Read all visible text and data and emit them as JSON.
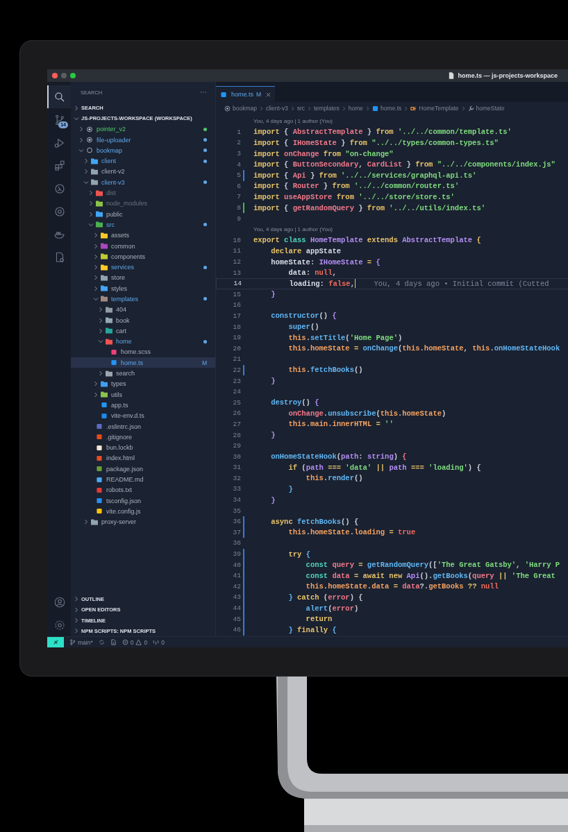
{
  "window": {
    "title": "home.ts — js-projects-workspace"
  },
  "activity_bar": {
    "items": [
      {
        "selected": true
      },
      {
        "selected": false,
        "badge": "14"
      },
      {
        "selected": false
      },
      {
        "selected": false
      },
      {
        "selected": false
      },
      {
        "selected": false
      },
      {
        "selected": false
      },
      {
        "selected": false
      }
    ]
  },
  "sidebar": {
    "title": "SEARCH",
    "sections": [
      {
        "label": "SEARCH",
        "expanded": false
      },
      {
        "label": "JS-PROJECTS-WORKSPACE (WORKSPACE)",
        "expanded": true,
        "children": [
          {
            "label": "pointer_v2",
            "kind": "root",
            "untracked": true,
            "modified": false,
            "ignored": false,
            "expanded": false,
            "selected": false
          },
          {
            "label": "file-uploader",
            "kind": "root",
            "untracked": false,
            "modified": true,
            "ignored": false,
            "expanded": false,
            "selected": false
          },
          {
            "label": "bookmap",
            "kind": "root",
            "untracked": false,
            "modified": true,
            "ignored": false,
            "expanded": true,
            "selected": false,
            "children": [
              {
                "label": "client",
                "kind": "folder",
                "color": "#42a5f5",
                "untracked": false,
                "modified": true,
                "ignored": false,
                "expanded": false,
                "selected": false
              },
              {
                "label": "client-v2",
                "kind": "folder",
                "color": "#90a4ae",
                "untracked": false,
                "modified": false,
                "ignored": false,
                "expanded": false,
                "selected": false
              },
              {
                "label": "client-v3",
                "kind": "folder",
                "color": "#90a4ae",
                "untracked": false,
                "modified": true,
                "ignored": false,
                "expanded": true,
                "selected": false,
                "children": [
                  {
                    "label": "dist",
                    "kind": "folder",
                    "color": "#ef5350",
                    "untracked": false,
                    "modified": false,
                    "ignored": true,
                    "expanded": false,
                    "selected": false
                  },
                  {
                    "label": "node_modules",
                    "kind": "folder",
                    "color": "#8bc34a",
                    "untracked": false,
                    "modified": false,
                    "ignored": true,
                    "expanded": false,
                    "selected": false
                  },
                  {
                    "label": "public",
                    "kind": "folder",
                    "color": "#42a5f5",
                    "untracked": false,
                    "modified": false,
                    "ignored": false,
                    "expanded": false,
                    "selected": false
                  },
                  {
                    "label": "src",
                    "kind": "folder",
                    "color": "#4caf50",
                    "untracked": false,
                    "modified": true,
                    "ignored": false,
                    "expanded": true,
                    "selected": false,
                    "children": [
                      {
                        "label": "assets",
                        "kind": "folder",
                        "color": "#ffca28",
                        "untracked": false,
                        "modified": false,
                        "ignored": false,
                        "expanded": false,
                        "selected": false
                      },
                      {
                        "label": "common",
                        "kind": "folder",
                        "color": "#ab47bc",
                        "untracked": false,
                        "modified": false,
                        "ignored": false,
                        "expanded": false,
                        "selected": false
                      },
                      {
                        "label": "components",
                        "kind": "folder",
                        "color": "#c0ca33",
                        "untracked": false,
                        "modified": false,
                        "ignored": false,
                        "expanded": false,
                        "selected": false
                      },
                      {
                        "label": "services",
                        "kind": "folder",
                        "color": "#ffca28",
                        "untracked": false,
                        "modified": true,
                        "ignored": false,
                        "expanded": false,
                        "selected": false
                      },
                      {
                        "label": "store",
                        "kind": "folder",
                        "color": "#90a4ae",
                        "untracked": false,
                        "modified": false,
                        "ignored": false,
                        "expanded": false,
                        "selected": false
                      },
                      {
                        "label": "styles",
                        "kind": "folder",
                        "color": "#42a5f5",
                        "untracked": false,
                        "modified": false,
                        "ignored": false,
                        "expanded": false,
                        "selected": false
                      },
                      {
                        "label": "templates",
                        "kind": "folder",
                        "color": "#a1887f",
                        "untracked": false,
                        "modified": true,
                        "ignored": false,
                        "expanded": true,
                        "selected": false,
                        "children": [
                          {
                            "label": "404",
                            "kind": "folder",
                            "color": "#8f9ba5",
                            "untracked": false,
                            "modified": false,
                            "ignored": false,
                            "expanded": false,
                            "selected": false
                          },
                          {
                            "label": "book",
                            "kind": "folder",
                            "color": "#96a8b2",
                            "untracked": false,
                            "modified": false,
                            "ignored": false,
                            "expanded": false,
                            "selected": false
                          },
                          {
                            "label": "cart",
                            "kind": "folder",
                            "color": "#26a69a",
                            "untracked": false,
                            "modified": false,
                            "ignored": false,
                            "expanded": false,
                            "selected": false
                          },
                          {
                            "label": "home",
                            "kind": "folder",
                            "color": "#ef5350",
                            "untracked": false,
                            "modified": true,
                            "ignored": false,
                            "expanded": true,
                            "selected": false,
                            "children": [
                              {
                                "label": "home.scss",
                                "kind": "file",
                                "color": "#ec407a",
                                "untracked": false,
                                "modified": false,
                                "ignored": false,
                                "selected": false
                              },
                              {
                                "label": "home.ts",
                                "kind": "file",
                                "color": "#2196f3",
                                "untracked": false,
                                "modified": true,
                                "ignored": false,
                                "badge": "M",
                                "selected": true
                              }
                            ]
                          },
                          {
                            "label": "search",
                            "kind": "folder",
                            "color": "#9aa6b0",
                            "untracked": false,
                            "modified": false,
                            "ignored": false,
                            "expanded": false,
                            "selected": false
                          }
                        ]
                      },
                      {
                        "label": "types",
                        "kind": "folder",
                        "color": "#3f9ff0",
                        "untracked": false,
                        "modified": false,
                        "ignored": false,
                        "expanded": false,
                        "selected": false
                      },
                      {
                        "label": "utils",
                        "kind": "folder",
                        "color": "#8bc34b",
                        "untracked": false,
                        "modified": false,
                        "ignored": false,
                        "expanded": false,
                        "selected": false
                      },
                      {
                        "label": "app.ts",
                        "kind": "file",
                        "color": "#2196f4",
                        "untracked": false,
                        "modified": false,
                        "ignored": false,
                        "selected": false
                      },
                      {
                        "label": "vite-env.d.ts",
                        "kind": "file",
                        "color": "#1e88e5",
                        "untracked": false,
                        "modified": false,
                        "ignored": false,
                        "selected": false
                      }
                    ]
                  },
                  {
                    "label": ".eslintrc.json",
                    "kind": "file",
                    "color": "#5c6bc0",
                    "untracked": false,
                    "modified": false,
                    "ignored": false,
                    "selected": false
                  },
                  {
                    "label": ".gitignore",
                    "kind": "file",
                    "color": "#e64a19",
                    "untracked": false,
                    "modified": false,
                    "ignored": false,
                    "selected": false
                  },
                  {
                    "label": "bun.lockb",
                    "kind": "file",
                    "color": "#f5e6d3",
                    "untracked": false,
                    "modified": false,
                    "ignored": false,
                    "selected": false
                  },
                  {
                    "label": "index.html",
                    "kind": "file",
                    "color": "#e44d26",
                    "untracked": false,
                    "modified": false,
                    "ignored": false,
                    "selected": false
                  },
                  {
                    "label": "package.json",
                    "kind": "file",
                    "color": "#689f38",
                    "untracked": false,
                    "modified": false,
                    "ignored": false,
                    "selected": false
                  },
                  {
                    "label": "README.md",
                    "kind": "file",
                    "color": "#4aa8f5",
                    "untracked": false,
                    "modified": false,
                    "ignored": false,
                    "selected": false
                  },
                  {
                    "label": "robots.txt",
                    "kind": "file",
                    "color": "#e53935",
                    "untracked": false,
                    "modified": false,
                    "ignored": false,
                    "selected": false
                  },
                  {
                    "label": "tsconfig.json",
                    "kind": "file",
                    "color": "#2a8ef0",
                    "untracked": false,
                    "modified": false,
                    "ignored": false,
                    "selected": false
                  },
                  {
                    "label": "vite.config.js",
                    "kind": "file",
                    "color": "#ffc107",
                    "untracked": false,
                    "modified": false,
                    "ignored": false,
                    "selected": false
                  }
                ]
              },
              {
                "label": "proxy-server",
                "kind": "folder",
                "color": "#91a5af",
                "untracked": false,
                "modified": false,
                "ignored": false,
                "expanded": false,
                "selected": false
              }
            ]
          }
        ]
      }
    ],
    "bottom_sections": [
      {
        "label": "OUTLINE",
        "expanded": false
      },
      {
        "label": "OPEN EDITORS",
        "expanded": false
      },
      {
        "label": "TIMELINE",
        "expanded": false
      },
      {
        "label": "NPM SCRIPTS: NPM SCRIPTS",
        "expanded": false
      }
    ]
  },
  "editor": {
    "tabs": [
      {
        "label": "home.ts",
        "badge": "M",
        "selected": true
      }
    ],
    "breadcrumb": [
      {
        "kind": "root",
        "label": "bookmap"
      },
      {
        "kind": "folder",
        "label": "client-v3"
      },
      {
        "kind": "folder",
        "label": "src"
      },
      {
        "kind": "folder",
        "label": "templates"
      },
      {
        "kind": "folder",
        "label": "home"
      },
      {
        "kind": "file",
        "label": "home.ts"
      },
      {
        "kind": "class",
        "label": "HomeTemplate"
      },
      {
        "kind": "property",
        "label": "homeState"
      }
    ],
    "lines": [
      {
        "kind": "lens",
        "text": "You, 4 days ago | 1 author (You)"
      },
      {
        "kind": "code",
        "number": "1",
        "current": false,
        "added": false,
        "modified": false,
        "tokens": [
          {
            "kind": "kw",
            "text": "import "
          },
          {
            "kind": "punct",
            "text": "{ "
          },
          {
            "kind": "name",
            "text": "AbstractTemplate"
          },
          {
            "kind": "punct",
            "text": " } "
          },
          {
            "kind": "kw",
            "text": "from "
          },
          {
            "kind": "str",
            "text": "'../../common/template.ts'"
          }
        ]
      },
      {
        "kind": "code",
        "number": "2",
        "current": false,
        "added": false,
        "modified": false,
        "tokens": [
          {
            "kind": "kw",
            "text": "import "
          },
          {
            "kind": "punct",
            "text": "{ "
          },
          {
            "kind": "name",
            "text": "IHomeState"
          },
          {
            "kind": "punct",
            "text": " } "
          },
          {
            "kind": "kw",
            "text": "from "
          },
          {
            "kind": "str",
            "text": "\"../../types/common-types.ts\""
          }
        ]
      },
      {
        "kind": "code",
        "number": "3",
        "current": false,
        "added": false,
        "modified": false,
        "tokens": [
          {
            "kind": "kw",
            "text": "import "
          },
          {
            "kind": "name",
            "text": "onChange "
          },
          {
            "kind": "kw",
            "text": "from "
          },
          {
            "kind": "str",
            "text": "\"on-change\""
          }
        ]
      },
      {
        "kind": "code",
        "number": "4",
        "current": false,
        "added": false,
        "modified": false,
        "tokens": [
          {
            "kind": "kw",
            "text": "import "
          },
          {
            "kind": "punct",
            "text": "{ "
          },
          {
            "kind": "name",
            "text": "ButtonSecondary"
          },
          {
            "kind": "punct",
            "text": ", "
          },
          {
            "kind": "name",
            "text": "CardList"
          },
          {
            "kind": "punct",
            "text": " } "
          },
          {
            "kind": "kw",
            "text": "from "
          },
          {
            "kind": "str",
            "text": "\"../../components/index.js\""
          }
        ]
      },
      {
        "kind": "code",
        "number": "5",
        "current": false,
        "added": false,
        "modified": true,
        "tokens": [
          {
            "kind": "kw",
            "text": "import "
          },
          {
            "kind": "punct",
            "text": "{ "
          },
          {
            "kind": "name",
            "text": "Api"
          },
          {
            "kind": "punct",
            "text": " } "
          },
          {
            "kind": "kw",
            "text": "from "
          },
          {
            "kind": "str",
            "text": "'../../services/graphql-api.ts'"
          }
        ]
      },
      {
        "kind": "code",
        "number": "6",
        "current": false,
        "added": false,
        "modified": false,
        "tokens": [
          {
            "kind": "kw",
            "text": "import "
          },
          {
            "kind": "punct",
            "text": "{ "
          },
          {
            "kind": "name",
            "text": "Router"
          },
          {
            "kind": "punct",
            "text": " } "
          },
          {
            "kind": "kw",
            "text": "from "
          },
          {
            "kind": "str",
            "text": "'../../common/router.ts'"
          }
        ]
      },
      {
        "kind": "code",
        "number": "7",
        "current": false,
        "added": false,
        "modified": false,
        "tokens": [
          {
            "kind": "kw",
            "text": "import "
          },
          {
            "kind": "name",
            "text": "useAppStore "
          },
          {
            "kind": "kw",
            "text": "from "
          },
          {
            "kind": "str",
            "text": "'../../store/store.ts'"
          }
        ]
      },
      {
        "kind": "code",
        "number": "8",
        "current": false,
        "added": true,
        "modified": false,
        "tokens": [
          {
            "kind": "kw",
            "text": "import "
          },
          {
            "kind": "punct",
            "text": "{ "
          },
          {
            "kind": "name",
            "text": "getRandomQuery"
          },
          {
            "kind": "punct",
            "text": " } "
          },
          {
            "kind": "kw",
            "text": "from "
          },
          {
            "kind": "str",
            "text": "'../../utils/index.ts'"
          }
        ]
      },
      {
        "kind": "code",
        "number": "9",
        "current": false,
        "added": false,
        "modified": false
      },
      {
        "kind": "lens",
        "text": "You, 4 days ago | 1 author (You)"
      },
      {
        "kind": "code",
        "number": "10",
        "current": false,
        "added": false,
        "modified": false,
        "tokens": [
          {
            "kind": "kw",
            "text": "export "
          },
          {
            "kind": "kw2",
            "text": "class "
          },
          {
            "kind": "type",
            "text": "HomeTemplate "
          },
          {
            "kind": "kw",
            "text": "extends "
          },
          {
            "kind": "type",
            "text": "AbstractTemplate "
          },
          {
            "kind": "op",
            "text": "{"
          }
        ]
      },
      {
        "kind": "code",
        "number": "11",
        "current": false,
        "added": false,
        "modified": false,
        "tokens": [
          {
            "kind": "kw",
            "text": "    declare "
          },
          {
            "kind": "plain",
            "text": "appState"
          }
        ]
      },
      {
        "kind": "code",
        "number": "12",
        "current": false,
        "added": false,
        "modified": false,
        "tokens": [
          {
            "kind": "plain",
            "text": "    homeState"
          },
          {
            "kind": "punct",
            "text": ": "
          },
          {
            "kind": "type",
            "text": "IHomeState "
          },
          {
            "kind": "op",
            "text": "= "
          },
          {
            "kind": "type",
            "text": "{"
          }
        ]
      },
      {
        "kind": "code",
        "number": "13",
        "current": false,
        "added": false,
        "modified": false,
        "tokens": [
          {
            "kind": "plain",
            "text": "        data"
          },
          {
            "kind": "punct",
            "text": ": "
          },
          {
            "kind": "lit",
            "text": "null"
          },
          {
            "kind": "punct",
            "text": ","
          }
        ]
      },
      {
        "kind": "code",
        "number": "14",
        "current": true,
        "added": false,
        "modified": false,
        "blame": "You, 4 days ago • Initial commit (Cutted",
        "tokens": [
          {
            "kind": "plain",
            "text": "        loading"
          },
          {
            "kind": "punct",
            "text": ": "
          },
          {
            "kind": "lit",
            "text": "false"
          },
          {
            "kind": "punct",
            "text": ","
          }
        ]
      },
      {
        "kind": "code",
        "number": "15",
        "current": false,
        "added": false,
        "modified": false,
        "tokens": [
          {
            "kind": "type",
            "text": "    }"
          }
        ]
      },
      {
        "kind": "code",
        "number": "16",
        "current": false,
        "added": false,
        "modified": false
      },
      {
        "kind": "code",
        "number": "17",
        "current": false,
        "added": false,
        "modified": false,
        "tokens": [
          {
            "kind": "fn",
            "text": "    constructor"
          },
          {
            "kind": "punct",
            "text": "() "
          },
          {
            "kind": "type",
            "text": "{"
          }
        ]
      },
      {
        "kind": "code",
        "number": "18",
        "current": false,
        "added": false,
        "modified": false,
        "tokens": [
          {
            "kind": "fn",
            "text": "        super"
          },
          {
            "kind": "punct",
            "text": "()"
          }
        ]
      },
      {
        "kind": "code",
        "number": "19",
        "current": false,
        "added": false,
        "modified": false,
        "tokens": [
          {
            "kind": "this",
            "text": "        this"
          },
          {
            "kind": "punct",
            "text": "."
          },
          {
            "kind": "fn",
            "text": "setTitle"
          },
          {
            "kind": "punct",
            "text": "("
          },
          {
            "kind": "str",
            "text": "'Home Page'"
          },
          {
            "kind": "punct",
            "text": ")"
          }
        ]
      },
      {
        "kind": "code",
        "number": "20",
        "current": false,
        "added": false,
        "modified": false,
        "tokens": [
          {
            "kind": "this",
            "text": "        this"
          },
          {
            "kind": "punct",
            "text": "."
          },
          {
            "kind": "prop",
            "text": "homeState "
          },
          {
            "kind": "op",
            "text": "= "
          },
          {
            "kind": "fn",
            "text": "onChange"
          },
          {
            "kind": "punct",
            "text": "("
          },
          {
            "kind": "this",
            "text": "this"
          },
          {
            "kind": "punct",
            "text": "."
          },
          {
            "kind": "prop",
            "text": "homeState"
          },
          {
            "kind": "punct",
            "text": ", "
          },
          {
            "kind": "this",
            "text": "this"
          },
          {
            "kind": "punct",
            "text": "."
          },
          {
            "kind": "fn",
            "text": "onHomeStateHook"
          }
        ]
      },
      {
        "kind": "code",
        "number": "21",
        "current": false,
        "added": false,
        "modified": false
      },
      {
        "kind": "code",
        "number": "22",
        "current": false,
        "added": false,
        "modified": true,
        "tokens": [
          {
            "kind": "this",
            "text": "        this"
          },
          {
            "kind": "punct",
            "text": "."
          },
          {
            "kind": "fn",
            "text": "fetchBooks"
          },
          {
            "kind": "punct",
            "text": "()"
          }
        ]
      },
      {
        "kind": "code",
        "number": "23",
        "current": false,
        "added": false,
        "modified": false,
        "tokens": [
          {
            "kind": "type",
            "text": "    }"
          }
        ]
      },
      {
        "kind": "code",
        "number": "24",
        "current": false,
        "added": false,
        "modified": false
      },
      {
        "kind": "code",
        "number": "25",
        "current": false,
        "added": false,
        "modified": false,
        "tokens": [
          {
            "kind": "fn",
            "text": "    destroy"
          },
          {
            "kind": "punct",
            "text": "() "
          },
          {
            "kind": "type",
            "text": "{"
          }
        ]
      },
      {
        "kind": "code",
        "number": "26",
        "current": false,
        "added": false,
        "modified": false,
        "tokens": [
          {
            "kind": "name",
            "text": "        onChange"
          },
          {
            "kind": "punct",
            "text": "."
          },
          {
            "kind": "fn",
            "text": "unsubscribe"
          },
          {
            "kind": "punct",
            "text": "("
          },
          {
            "kind": "this",
            "text": "this"
          },
          {
            "kind": "punct",
            "text": "."
          },
          {
            "kind": "prop",
            "text": "homeState"
          },
          {
            "kind": "punct",
            "text": ")"
          }
        ]
      },
      {
        "kind": "code",
        "number": "27",
        "current": false,
        "added": false,
        "modified": false,
        "tokens": [
          {
            "kind": "this",
            "text": "        this"
          },
          {
            "kind": "punct",
            "text": "."
          },
          {
            "kind": "prop",
            "text": "main"
          },
          {
            "kind": "punct",
            "text": "."
          },
          {
            "kind": "prop",
            "text": "innerHTML "
          },
          {
            "kind": "op",
            "text": "= "
          },
          {
            "kind": "str",
            "text": "''"
          }
        ]
      },
      {
        "kind": "code",
        "number": "28",
        "current": false,
        "added": false,
        "modified": false,
        "tokens": [
          {
            "kind": "type",
            "text": "    }"
          }
        ]
      },
      {
        "kind": "code",
        "number": "29",
        "current": false,
        "added": false,
        "modified": false
      },
      {
        "kind": "code",
        "number": "30",
        "current": false,
        "added": false,
        "modified": false,
        "tokens": [
          {
            "kind": "fn",
            "text": "    onHomeStateHook"
          },
          {
            "kind": "punct",
            "text": "("
          },
          {
            "kind": "type",
            "text": "path"
          },
          {
            "kind": "punct",
            "text": ": "
          },
          {
            "kind": "type",
            "text": "string"
          },
          {
            "kind": "punct",
            "text": ") "
          },
          {
            "kind": "name",
            "text": "{"
          }
        ]
      },
      {
        "kind": "code",
        "number": "31",
        "current": false,
        "added": false,
        "modified": false,
        "tokens": [
          {
            "kind": "kw",
            "text": "        if "
          },
          {
            "kind": "punct",
            "text": "("
          },
          {
            "kind": "type",
            "text": "path "
          },
          {
            "kind": "op",
            "text": "=== "
          },
          {
            "kind": "str",
            "text": "'data' "
          },
          {
            "kind": "op",
            "text": "|| "
          },
          {
            "kind": "type",
            "text": "path "
          },
          {
            "kind": "op",
            "text": "=== "
          },
          {
            "kind": "str",
            "text": "'loading'"
          },
          {
            "kind": "punct",
            "text": ") {"
          }
        ]
      },
      {
        "kind": "code",
        "number": "32",
        "current": false,
        "added": false,
        "modified": false,
        "tokens": [
          {
            "kind": "this",
            "text": "            this"
          },
          {
            "kind": "punct",
            "text": "."
          },
          {
            "kind": "fn",
            "text": "render"
          },
          {
            "kind": "punct",
            "text": "()"
          }
        ]
      },
      {
        "kind": "code",
        "number": "33",
        "current": false,
        "added": false,
        "modified": false,
        "tokens": [
          {
            "kind": "fn",
            "text": "        }"
          }
        ]
      },
      {
        "kind": "code",
        "number": "34",
        "current": false,
        "added": false,
        "modified": false,
        "tokens": [
          {
            "kind": "type",
            "text": "    }"
          }
        ]
      },
      {
        "kind": "code",
        "number": "35",
        "current": false,
        "added": false,
        "modified": false
      },
      {
        "kind": "code",
        "number": "36",
        "current": false,
        "added": false,
        "modified": true,
        "tokens": [
          {
            "kind": "kw",
            "text": "    async "
          },
          {
            "kind": "fn",
            "text": "fetchBooks"
          },
          {
            "kind": "punct",
            "text": "() {"
          }
        ]
      },
      {
        "kind": "code",
        "number": "37",
        "current": false,
        "added": false,
        "modified": true,
        "tokens": [
          {
            "kind": "this",
            "text": "        this"
          },
          {
            "kind": "punct",
            "text": "."
          },
          {
            "kind": "prop",
            "text": "homeState"
          },
          {
            "kind": "punct",
            "text": "."
          },
          {
            "kind": "prop",
            "text": "loading "
          },
          {
            "kind": "op",
            "text": "= "
          },
          {
            "kind": "lit",
            "text": "true"
          }
        ]
      },
      {
        "kind": "code",
        "number": "38",
        "current": false,
        "added": false,
        "modified": false
      },
      {
        "kind": "code",
        "number": "39",
        "current": false,
        "added": false,
        "modified": true,
        "tokens": [
          {
            "kind": "kw",
            "text": "        try "
          },
          {
            "kind": "fn",
            "text": "{"
          }
        ]
      },
      {
        "kind": "code",
        "number": "40",
        "current": false,
        "added": false,
        "modified": true,
        "tokens": [
          {
            "kind": "kw2",
            "text": "            const "
          },
          {
            "kind": "name",
            "text": "query "
          },
          {
            "kind": "op",
            "text": "= "
          },
          {
            "kind": "fn",
            "text": "getRandomQuery"
          },
          {
            "kind": "punct",
            "text": "(["
          },
          {
            "kind": "str",
            "text": "'The Great Gatsby'"
          },
          {
            "kind": "punct",
            "text": ", "
          },
          {
            "kind": "str",
            "text": "'Harry P"
          }
        ]
      },
      {
        "kind": "code",
        "number": "41",
        "current": false,
        "added": false,
        "modified": true,
        "tokens": [
          {
            "kind": "kw2",
            "text": "            const "
          },
          {
            "kind": "name",
            "text": "data "
          },
          {
            "kind": "op",
            "text": "= "
          },
          {
            "kind": "kw",
            "text": "await new "
          },
          {
            "kind": "type",
            "text": "Api"
          },
          {
            "kind": "punct",
            "text": "()."
          },
          {
            "kind": "fn",
            "text": "getBooks"
          },
          {
            "kind": "punct",
            "text": "("
          },
          {
            "kind": "name",
            "text": "query "
          },
          {
            "kind": "op",
            "text": "|| "
          },
          {
            "kind": "str",
            "text": "'The Great"
          }
        ]
      },
      {
        "kind": "code",
        "number": "42",
        "current": false,
        "added": false,
        "modified": true,
        "tokens": [
          {
            "kind": "this",
            "text": "            this"
          },
          {
            "kind": "punct",
            "text": "."
          },
          {
            "kind": "prop",
            "text": "homeState"
          },
          {
            "kind": "punct",
            "text": "."
          },
          {
            "kind": "prop",
            "text": "data "
          },
          {
            "kind": "op",
            "text": "= "
          },
          {
            "kind": "name",
            "text": "data"
          },
          {
            "kind": "punct",
            "text": "?."
          },
          {
            "kind": "prop",
            "text": "getBooks "
          },
          {
            "kind": "op",
            "text": "?? "
          },
          {
            "kind": "lit",
            "text": "null"
          }
        ]
      },
      {
        "kind": "code",
        "number": "43",
        "current": false,
        "added": false,
        "modified": true,
        "tokens": [
          {
            "kind": "fn",
            "text": "        } "
          },
          {
            "kind": "kw",
            "text": "catch "
          },
          {
            "kind": "punct",
            "text": "("
          },
          {
            "kind": "name",
            "text": "error"
          },
          {
            "kind": "punct",
            "text": ") {"
          }
        ]
      },
      {
        "kind": "code",
        "number": "44",
        "current": false,
        "added": false,
        "modified": true,
        "tokens": [
          {
            "kind": "fn",
            "text": "            alert"
          },
          {
            "kind": "punct",
            "text": "("
          },
          {
            "kind": "name",
            "text": "error"
          },
          {
            "kind": "punct",
            "text": ")"
          }
        ]
      },
      {
        "kind": "code",
        "number": "45",
        "current": false,
        "added": false,
        "modified": true,
        "tokens": [
          {
            "kind": "kw",
            "text": "            return"
          }
        ]
      },
      {
        "kind": "code",
        "number": "46",
        "current": false,
        "added": false,
        "modified": true,
        "tokens": [
          {
            "kind": "fn",
            "text": "        } "
          },
          {
            "kind": "kw",
            "text": "finally "
          },
          {
            "kind": "fn",
            "text": "{"
          }
        ]
      }
    ]
  },
  "status_bar": {
    "branch": "main*",
    "errors": "0",
    "warnings": "0",
    "ports": "0"
  }
}
